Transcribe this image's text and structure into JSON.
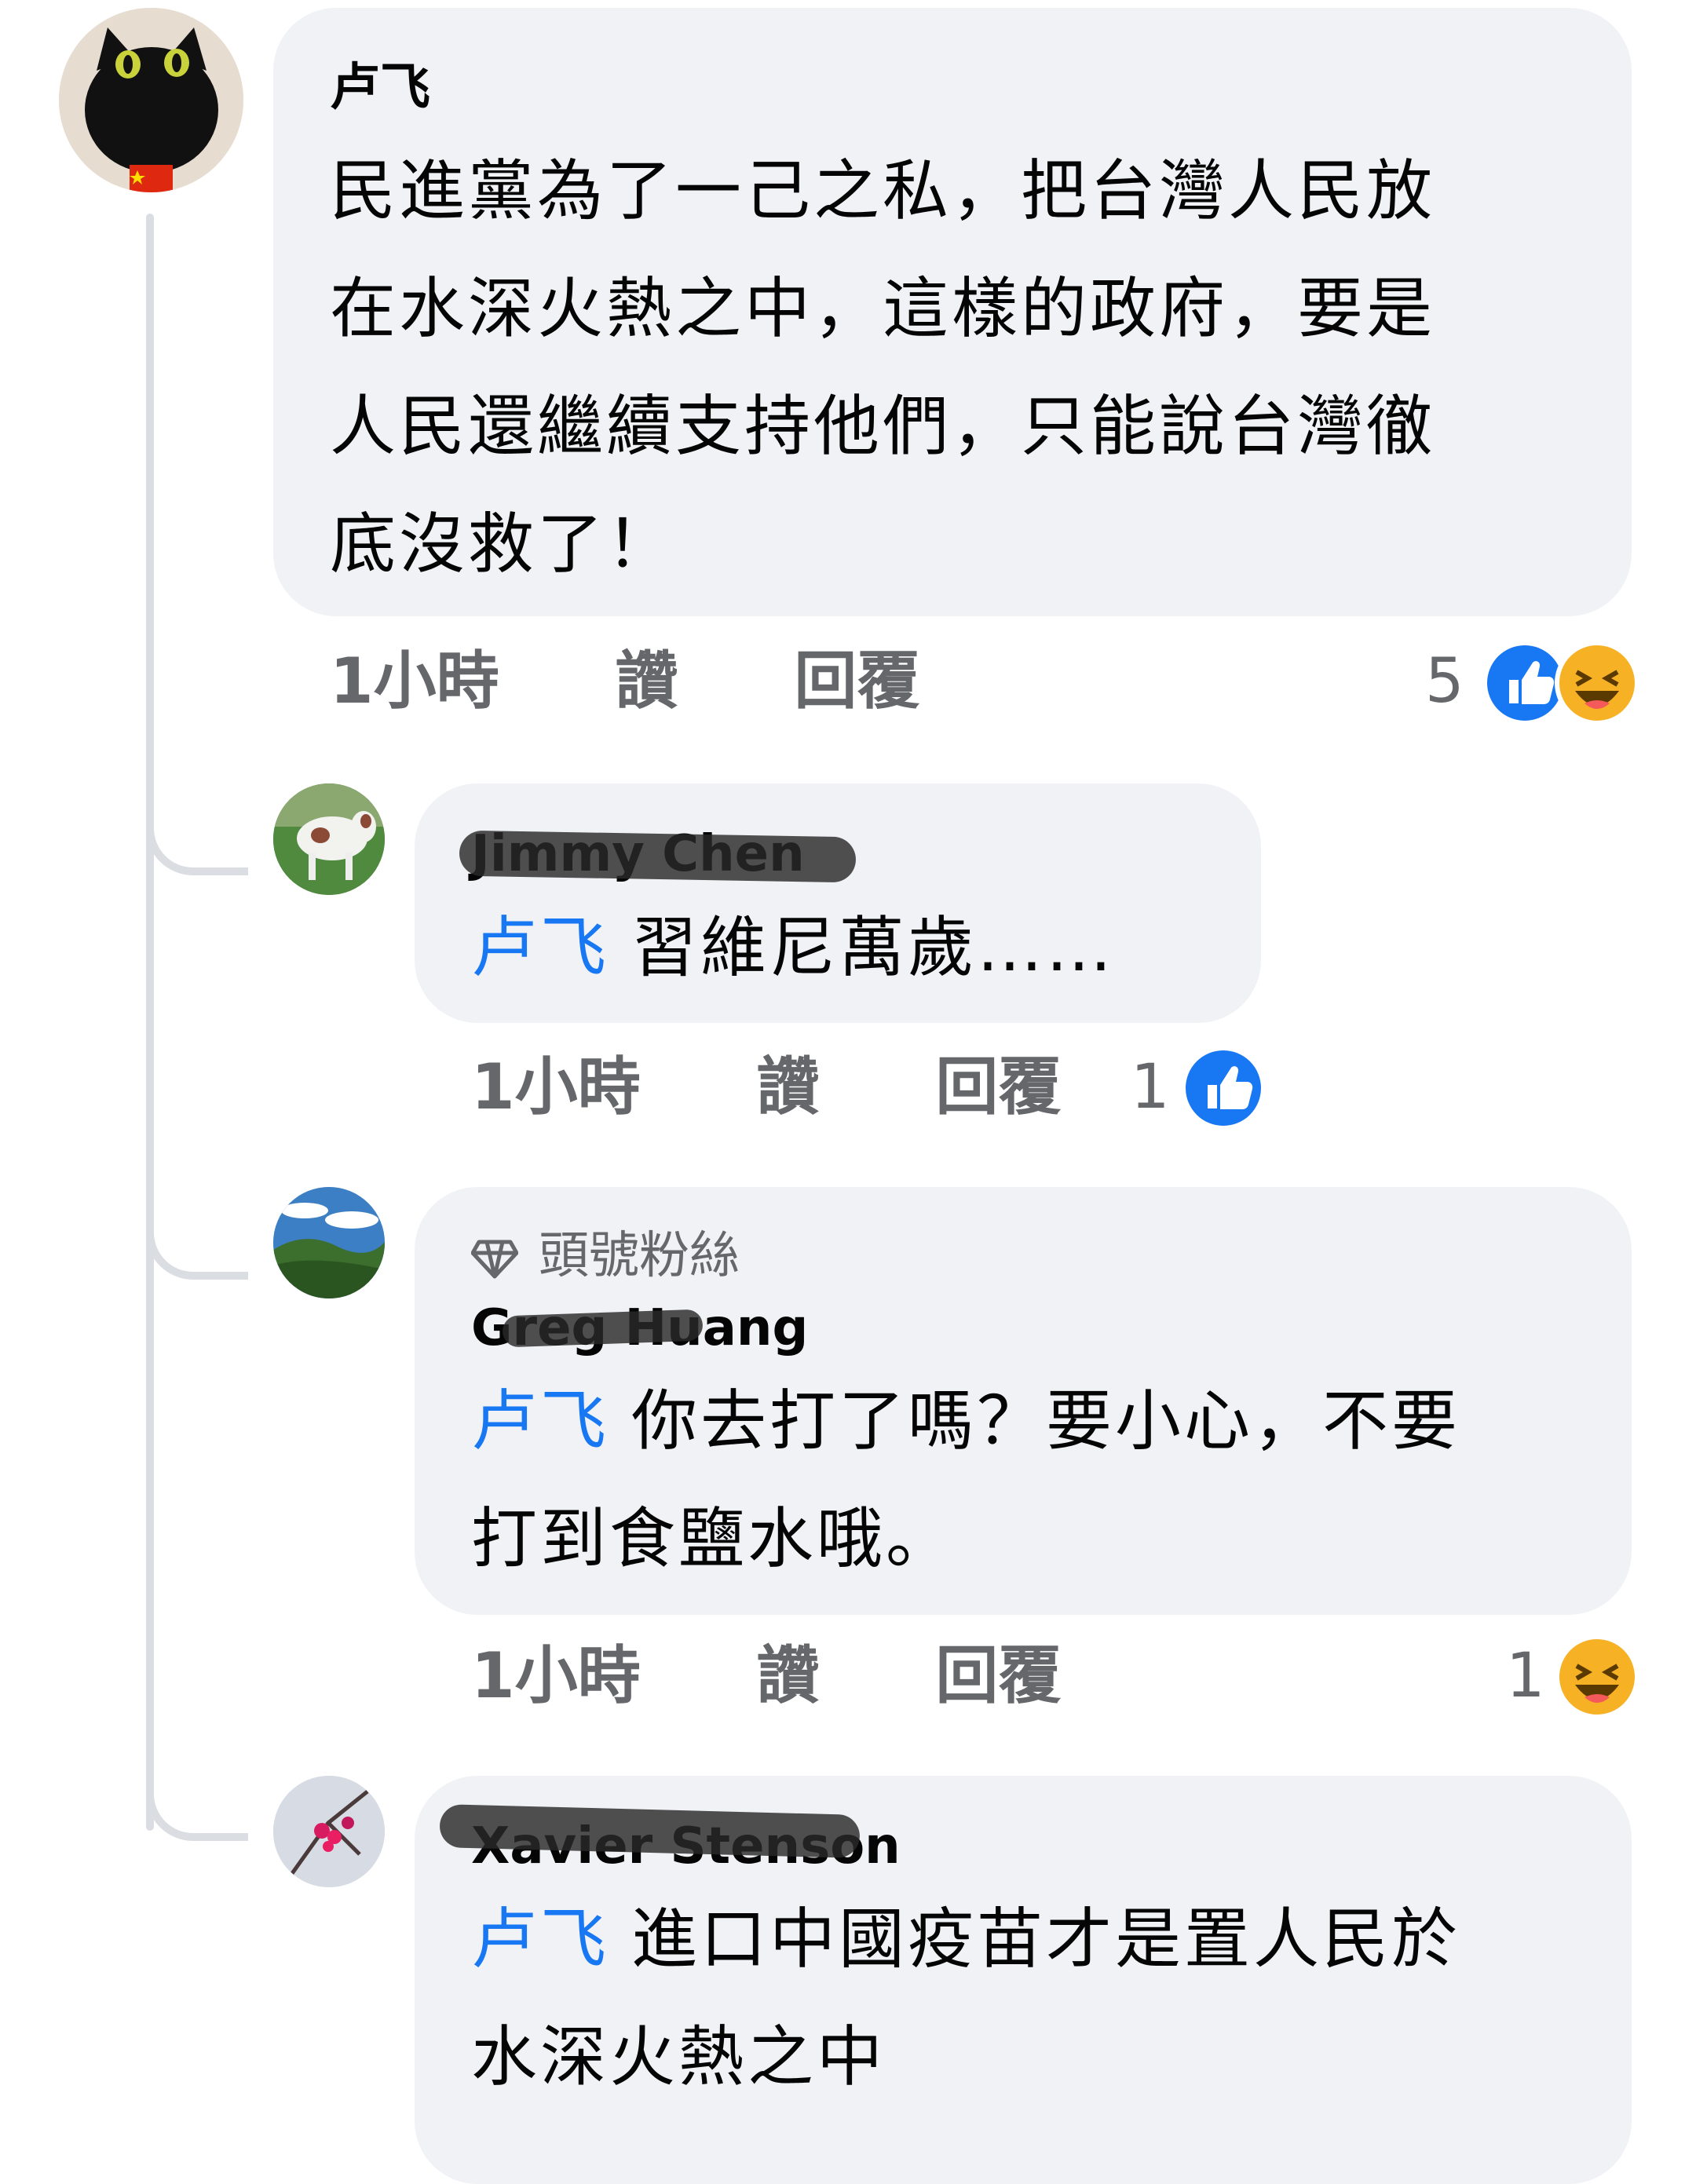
{
  "comment": {
    "author": "卢飞",
    "lines": [
      "民進黨為了一己之私，把台灣人民放",
      "在水深火熱之中，這樣的政府，要是",
      "人民還繼續支持他們，只能說台灣徹",
      "底沒救了！"
    ],
    "time": "1小時",
    "like_label": "讚",
    "reply_label": "回覆",
    "reaction_count": "5",
    "reactions": [
      "like-icon",
      "haha-icon"
    ]
  },
  "replies": [
    {
      "author": "Jimmy Chen",
      "mention": "卢飞",
      "lines": [
        "習維尼萬歲……"
      ],
      "time": "1小時",
      "like_label": "讚",
      "reply_label": "回覆",
      "reaction_count": "1",
      "reactions": [
        "like-icon"
      ]
    },
    {
      "badge": "頭號粉絲",
      "author": "Greg Huang",
      "mention": "卢飞",
      "lines": [
        "你去打了嗎？要小心，不要",
        "打到食鹽水哦。"
      ],
      "time": "1小時",
      "like_label": "讚",
      "reply_label": "回覆",
      "reaction_count": "1",
      "reactions": [
        "haha-icon"
      ]
    },
    {
      "author": "Xavier Stenson",
      "mention": "卢飞",
      "lines": [
        "進口中國疫苗才是置人民於",
        "水深火熱之中"
      ]
    }
  ],
  "colors": {
    "bubble": "#f0f2f5",
    "mention": "#1877f2",
    "like": "#1877f2",
    "haha": "#f7b125",
    "meta": "#65676b"
  }
}
